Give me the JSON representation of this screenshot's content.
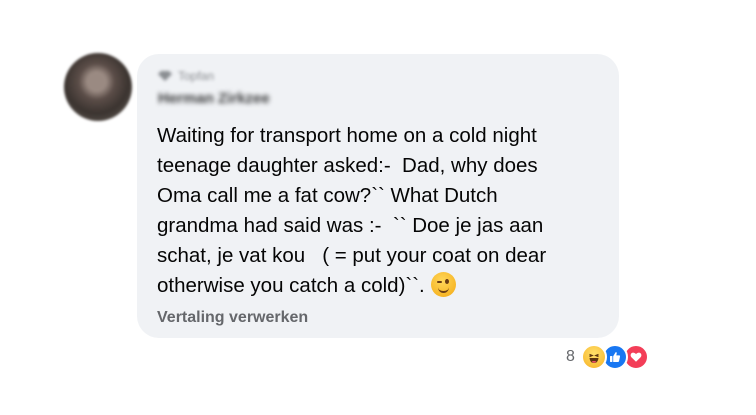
{
  "comment": {
    "badge_text": "Topfan",
    "author_name": "Herman Zirkzee",
    "text_lines": [
      "Waiting for transport home on a cold night",
      "teenage daughter asked:-  Dad, why does",
      "Oma call me a fat cow?`` What Dutch",
      "grandma had said was :-  `` Doe je jas aan",
      "schat, je vat kou   ( = put your coat on dear",
      "otherwise you catch a cold)``."
    ],
    "emoji": "winking-face",
    "translate_link": "Vertaling verwerken"
  },
  "reactions": {
    "count": "8",
    "types": [
      "haha",
      "like",
      "love"
    ]
  },
  "colors": {
    "bubble": "#f0f2f5",
    "text": "#050505",
    "secondary": "#65676b",
    "like": "#1877f2",
    "love": "#f33e58",
    "haha": "#f7b125"
  }
}
